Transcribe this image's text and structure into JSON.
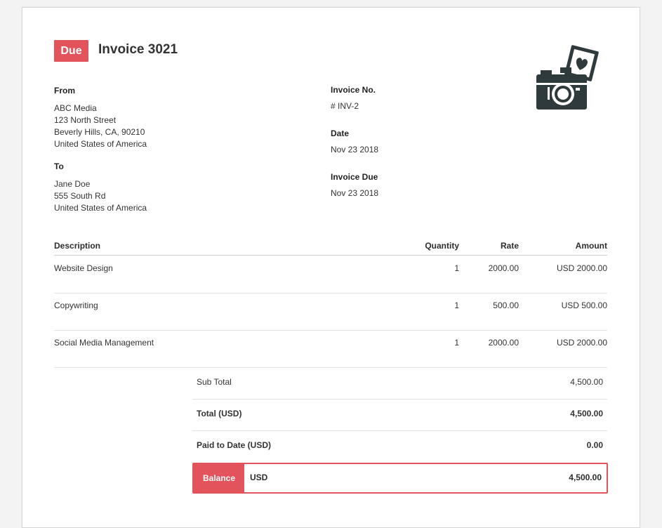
{
  "invoice": {
    "status": "Due",
    "title": "Invoice 3021",
    "logo_icon": "camera-heart-photo-icon"
  },
  "from": {
    "label": "From",
    "lines": [
      "ABC Media",
      "123 North Street",
      "Beverly Hills, CA, 90210",
      "United States of America"
    ]
  },
  "to": {
    "label": "To",
    "lines": [
      "Jane Doe",
      "555 South Rd",
      "United States of America"
    ]
  },
  "meta": {
    "invoice_no_label": "Invoice No.",
    "invoice_no": "# INV-2",
    "date_label": "Date",
    "date": "Nov 23 2018",
    "due_label": "Invoice Due",
    "due": "Nov 23 2018"
  },
  "items": {
    "headers": {
      "description": "Description",
      "quantity": "Quantity",
      "rate": "Rate",
      "amount": "Amount"
    },
    "rows": [
      {
        "description": "Website Design",
        "quantity": "1",
        "rate": "2000.00",
        "amount": "USD 2000.00"
      },
      {
        "description": "Copywriting",
        "quantity": "1",
        "rate": "500.00",
        "amount": "USD 500.00"
      },
      {
        "description": "Social Media Management",
        "quantity": "1",
        "rate": "2000.00",
        "amount": "USD 2000.00"
      }
    ]
  },
  "summary": {
    "subtotal_label": "Sub Total",
    "subtotal": "4,500.00",
    "total_label": "Total (USD)",
    "total": "4,500.00",
    "paid_label": "Paid to Date (USD)",
    "paid": "0.00",
    "balance_label": "Balance",
    "balance_currency": "USD",
    "balance": "4,500.00"
  },
  "colors": {
    "accent": "#e2535b",
    "logo_dark": "#2e3a3c"
  }
}
